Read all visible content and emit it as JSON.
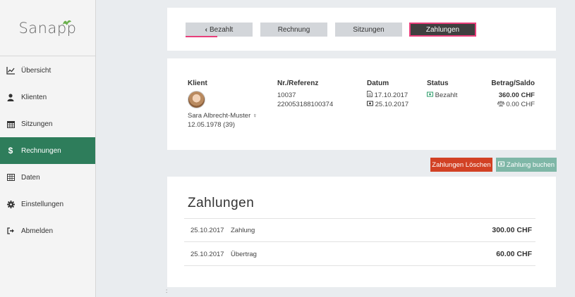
{
  "app": {
    "logo": "Sanapp"
  },
  "sidebar": {
    "items": [
      {
        "label": "Übersicht",
        "icon": "chart-line-icon"
      },
      {
        "label": "Klienten",
        "icon": "user-icon"
      },
      {
        "label": "Sitzungen",
        "icon": "calendar-icon"
      },
      {
        "label": "Rechnungen",
        "icon": "dollar-icon",
        "active": true
      },
      {
        "label": "Daten",
        "icon": "table-icon"
      },
      {
        "label": "Einstellungen",
        "icon": "gear-icon"
      },
      {
        "label": "Abmelden",
        "icon": "sign-out-icon"
      }
    ]
  },
  "tabs": {
    "back": "Bezahlt",
    "invoice": "Rechnung",
    "sessions": "Sitzungen",
    "payments": "Zahlungen"
  },
  "invoice": {
    "headers": {
      "client": "Klient",
      "reference": "Nr./Referenz",
      "date": "Datum",
      "status": "Status",
      "amount": "Betrag/Saldo"
    },
    "client_name": "Sara Albrecht-Muster",
    "client_birth": "12.05.1978 (39)",
    "number": "10037",
    "reference": "220053188100374",
    "invoice_date": "17.10.2017",
    "payment_date": "25.10.2017",
    "status": "Bezahlt",
    "amount": "360.00 CHF",
    "balance": "0.00 CHF"
  },
  "actions": {
    "delete_payments": "Zahlungen Löschen",
    "book_payment": "Zahlung buchen"
  },
  "payments": {
    "title": "Zahlungen",
    "rows": [
      {
        "date": "25.10.2017",
        "label": "Zahlung",
        "amount": "300.00 CHF"
      },
      {
        "date": "25.10.2017",
        "label": "Übertrag",
        "amount": "60.00 CHF"
      }
    ]
  },
  "footer_mark": ":",
  "colors": {
    "primary": "#2e7d5b",
    "danger": "#d24124",
    "success_light": "#7fb7a7",
    "highlight": "#e83e7a"
  }
}
